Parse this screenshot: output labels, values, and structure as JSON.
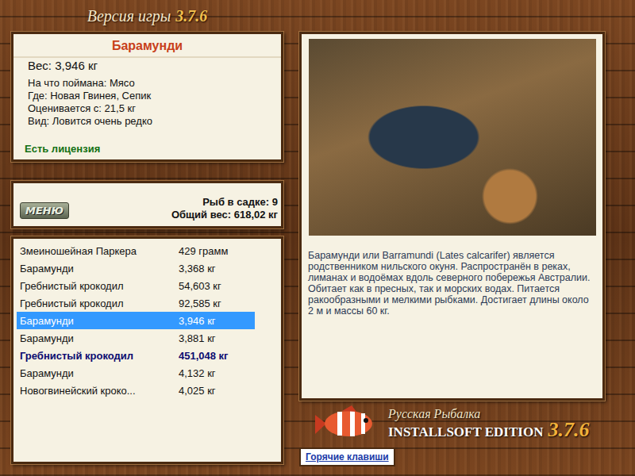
{
  "header": {
    "label": "Версия игры",
    "version": "3.7.6"
  },
  "fish_card": {
    "name": "Барамунди",
    "weight": "Вес: 3,946 кг",
    "details": [
      "На что поймана: Мясо",
      "Где: Новая Гвинея, Сепик",
      "Оценивается с: 21,5 кг",
      "Вид: Ловится очень редко"
    ],
    "license": "Есть лицензия"
  },
  "keepnet": {
    "menu_button": "МЕНЮ",
    "count": "Рыб в садке: 9",
    "total": "Общий вес: 618,02 кг"
  },
  "catch_list": [
    {
      "name": "Змеиношейная Паркера",
      "weight": "429 грамм",
      "selected": false,
      "emphasized": false
    },
    {
      "name": "Барамунди",
      "weight": "3,368 кг",
      "selected": false,
      "emphasized": false
    },
    {
      "name": "Гребнистый крокодил",
      "weight": "54,603 кг",
      "selected": false,
      "emphasized": false
    },
    {
      "name": "Гребнистый крокодил",
      "weight": "92,585 кг",
      "selected": false,
      "emphasized": false
    },
    {
      "name": "Барамунди",
      "weight": "3,946 кг",
      "selected": true,
      "emphasized": false
    },
    {
      "name": "Барамунди",
      "weight": "3,881 кг",
      "selected": false,
      "emphasized": false
    },
    {
      "name": "Гребнистый крокодил",
      "weight": "451,048 кг",
      "selected": false,
      "emphasized": true
    },
    {
      "name": "Барамунди",
      "weight": "4,132 кг",
      "selected": false,
      "emphasized": false
    },
    {
      "name": "Новогвинейский кроко...",
      "weight": "4,025 кг",
      "selected": false,
      "emphasized": false
    }
  ],
  "description": "Барамунди или Barramundi (Lates calcarifer) является родственником нильского окуня. Распространён в реках, лиманах и водоёмах вдоль северного побережья Австралии. Обитает как в пресных, так и морских водах. Питается ракообразными и мелкими рыбками. Достигает длины около 2 м и массы 60 кг.",
  "logo": {
    "title": "Русская Рыбалка",
    "edition": "INSTALLSOFT EDITION",
    "version": "3.7.6"
  },
  "hotkeys_button": "Горячие клавиши"
}
